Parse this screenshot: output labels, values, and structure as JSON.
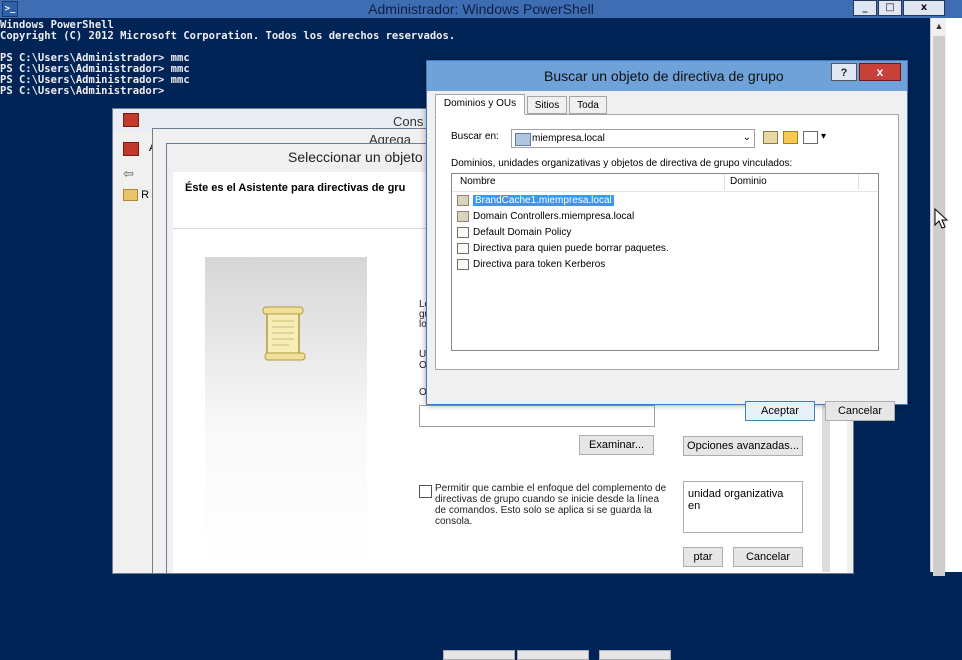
{
  "powershell": {
    "title": "Administrador: Windows PowerShell",
    "console_text": "Windows PowerShell\nCopyright (C) 2012 Microsoft Corporation. Todos los derechos reservados.\n\nPS C:\\Users\\Administrador> mmc\nPS C:\\Users\\Administrador> mmc\nPS C:\\Users\\Administrador> mmc\nPS C:\\Users\\Administrador>",
    "minimize_glyph": "_",
    "maximize_glyph": "□",
    "close_glyph": "x",
    "scroll_up_glyph": "▲"
  },
  "mmc": {
    "title": "Cons",
    "tree_item_fragment": "R",
    "mini_window_letter": "A"
  },
  "agregar": {
    "title": "Agrega"
  },
  "wizard": {
    "title": "Seleccionar un objeto",
    "header_text": "Éste es el Asistente para directivas de gru",
    "frag_l1": "Lo",
    "frag_l2": "gu",
    "frag_l3": "lo",
    "frag_u1": "U",
    "frag_u2": "O",
    "frag_o": "O",
    "examinar_label": "Examinar...",
    "permitir_text": "Permitir que cambie el enfoque del complemento de directivas de grupo cuando se inicie desde la línea de comandos. Esto solo se aplica si se guarda la consola.",
    "opciones_avanzadas_label": "Opciones avanzadas...",
    "ou_text": "unidad organizativa en",
    "aceptar_fragment": "ptar",
    "cancelar_label": "Cancelar"
  },
  "search_dialog": {
    "title": "Buscar un objeto de directiva de grupo",
    "help_glyph": "?",
    "close_glyph": "x",
    "tabs": [
      {
        "label": "Dominios y OUs"
      },
      {
        "label": "Sitios"
      },
      {
        "label": "Toda"
      }
    ],
    "buscar_en_label": "Buscar en:",
    "buscar_en_value": "miempresa.local",
    "dropdown_glyph": "⌄",
    "view_menu_glyph": "▾",
    "list_caption": "Dominios, unidades organizativas y objetos de directiva de grupo vinculados:",
    "columns": {
      "name": "Nombre",
      "domain": "Dominio"
    },
    "rows": [
      {
        "name": "BrandCache1.miempresa.local",
        "type": "ou",
        "selected": true
      },
      {
        "name": "Domain Controllers.miempresa.local",
        "type": "ou",
        "selected": false
      },
      {
        "name": "Default Domain Policy",
        "type": "gpo",
        "selected": false
      },
      {
        "name": "Directiva para quien puede borrar paquetes.",
        "type": "gpo",
        "selected": false
      },
      {
        "name": "Directiva para token Kerberos",
        "type": "gpo",
        "selected": false
      }
    ],
    "aceptar_label": "Aceptar",
    "cancelar_label": "Cancelar"
  },
  "colors": {
    "powershell_bg": "#012456",
    "titlebar_blue": "#6ea2d9",
    "selection_blue": "#3399ff",
    "close_red": "#c7403a"
  }
}
